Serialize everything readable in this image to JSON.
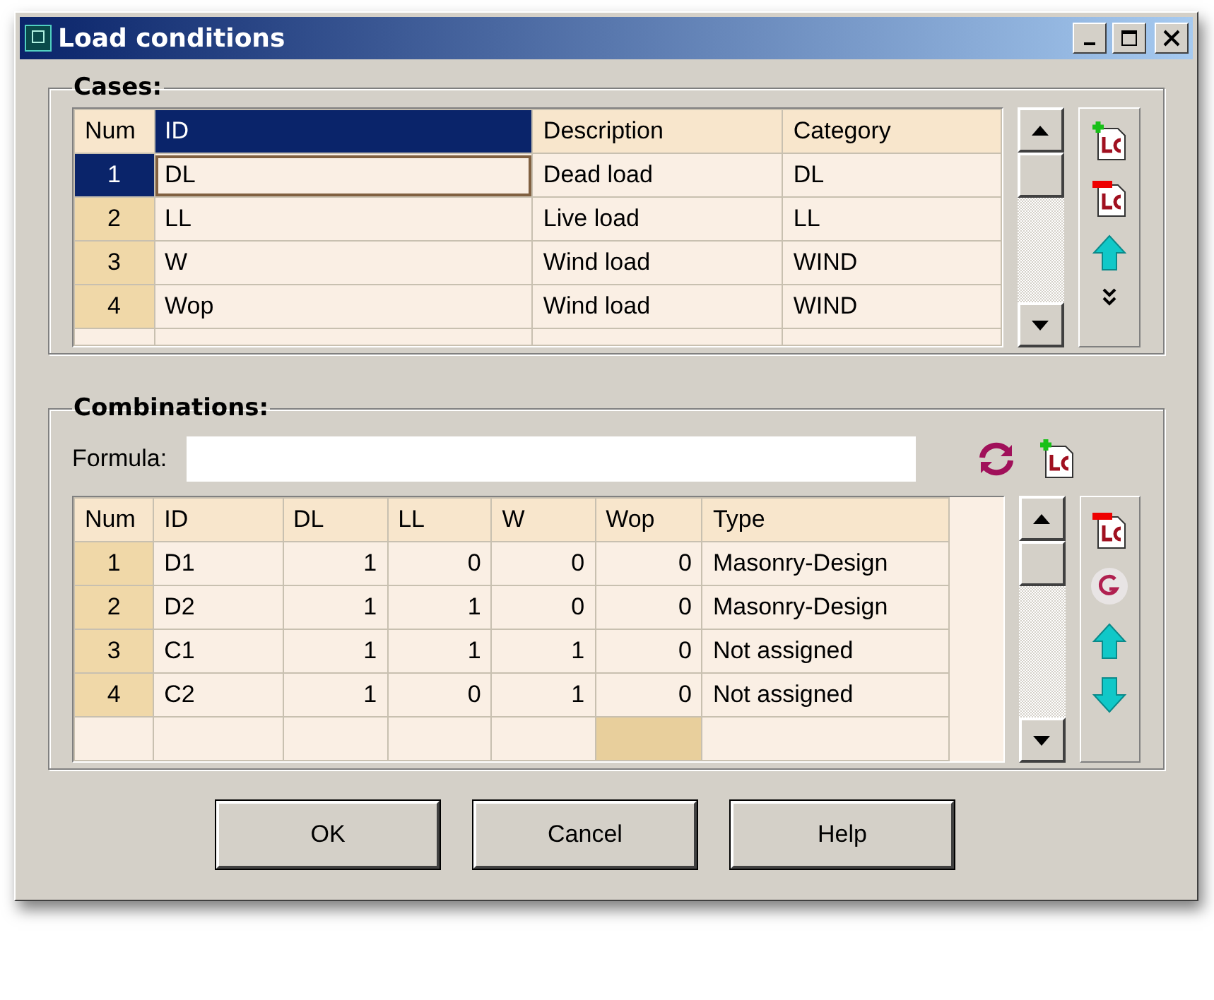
{
  "window": {
    "title": "Load conditions"
  },
  "cases": {
    "title": "Cases:",
    "columns": [
      {
        "label": "Num",
        "selected": false
      },
      {
        "label": "ID",
        "selected": true
      },
      {
        "label": "Description",
        "selected": false
      },
      {
        "label": "Category",
        "selected": false
      }
    ],
    "rows": [
      {
        "selected": true,
        "cells": [
          "1",
          "DL",
          "Dead load",
          "DL"
        ]
      },
      {
        "selected": false,
        "cells": [
          "2",
          "LL",
          "Live load",
          "LL"
        ]
      },
      {
        "selected": false,
        "cells": [
          "3",
          "W",
          "Wind load",
          "WIND"
        ]
      },
      {
        "selected": false,
        "cells": [
          "4",
          "Wop",
          "Wind load",
          "WIND"
        ]
      }
    ]
  },
  "combinations": {
    "title": "Combinations:",
    "formula": {
      "label": "Formula:"
    },
    "columns": [
      {
        "label": "Num",
        "selected": false
      },
      {
        "label": "ID",
        "selected": false
      },
      {
        "label": "DL",
        "selected": false
      },
      {
        "label": "LL",
        "selected": false
      },
      {
        "label": "W",
        "selected": false
      },
      {
        "label": "Wop",
        "selected": false
      },
      {
        "label": "Type",
        "selected": false
      }
    ],
    "rows": [
      {
        "selected": false,
        "cells": [
          "1",
          "D1",
          "1",
          "0",
          "0",
          "0",
          "Masonry-Design"
        ]
      },
      {
        "selected": false,
        "cells": [
          "2",
          "D2",
          "1",
          "1",
          "0",
          "0",
          "Masonry-Design"
        ]
      },
      {
        "selected": false,
        "cells": [
          "3",
          "C1",
          "1",
          "1",
          "1",
          "0",
          "Not assigned"
        ]
      },
      {
        "selected": false,
        "cells": [
          "4",
          "C2",
          "1",
          "0",
          "1",
          "0",
          "Not assigned"
        ]
      }
    ],
    "new_row": [
      {
        "selected": false
      },
      {
        "selected": false
      },
      {
        "selected": false
      },
      {
        "selected": false
      },
      {
        "selected": false
      },
      {
        "selected": true
      },
      {
        "selected": false
      }
    ]
  },
  "buttons": [
    "OK",
    "Cancel",
    "Help"
  ]
}
